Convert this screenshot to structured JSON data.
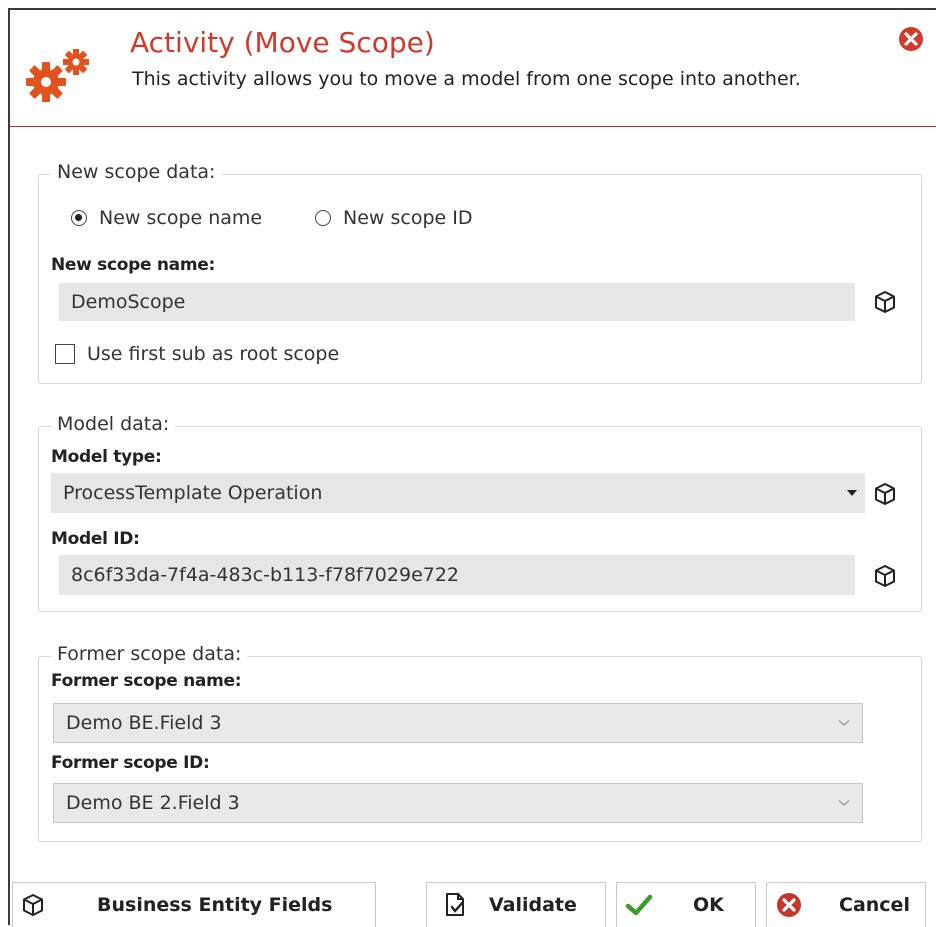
{
  "header": {
    "title": "Activity (Move Scope)",
    "subtitle": "This activity allows you to move a model from one scope into another.",
    "icon": "gears-icon",
    "accent_color": "#d0392b"
  },
  "new_scope": {
    "legend": "New scope data:",
    "radio_name_label": "New scope name",
    "radio_id_label": "New scope ID",
    "selected_radio": "New scope name",
    "name_label": "New scope name:",
    "name_value": "DemoScope",
    "checkbox_label": "Use first sub as root scope",
    "checkbox_checked": false
  },
  "model": {
    "legend": "Model data:",
    "type_label": "Model type:",
    "type_value": "ProcessTemplate Operation",
    "id_label": "Model ID:",
    "id_value": "8c6f33da-7f4a-483c-b113-f78f7029e722"
  },
  "former_scope": {
    "legend": "Former scope data:",
    "name_label": "Former scope name:",
    "name_value": "Demo BE.Field 3",
    "id_label": "Former scope ID:",
    "id_value": "Demo BE 2.Field 3"
  },
  "footer": {
    "bef_label": "Business Entity Fields",
    "validate_label": "Validate",
    "ok_label": "OK",
    "cancel_label": "Cancel"
  }
}
